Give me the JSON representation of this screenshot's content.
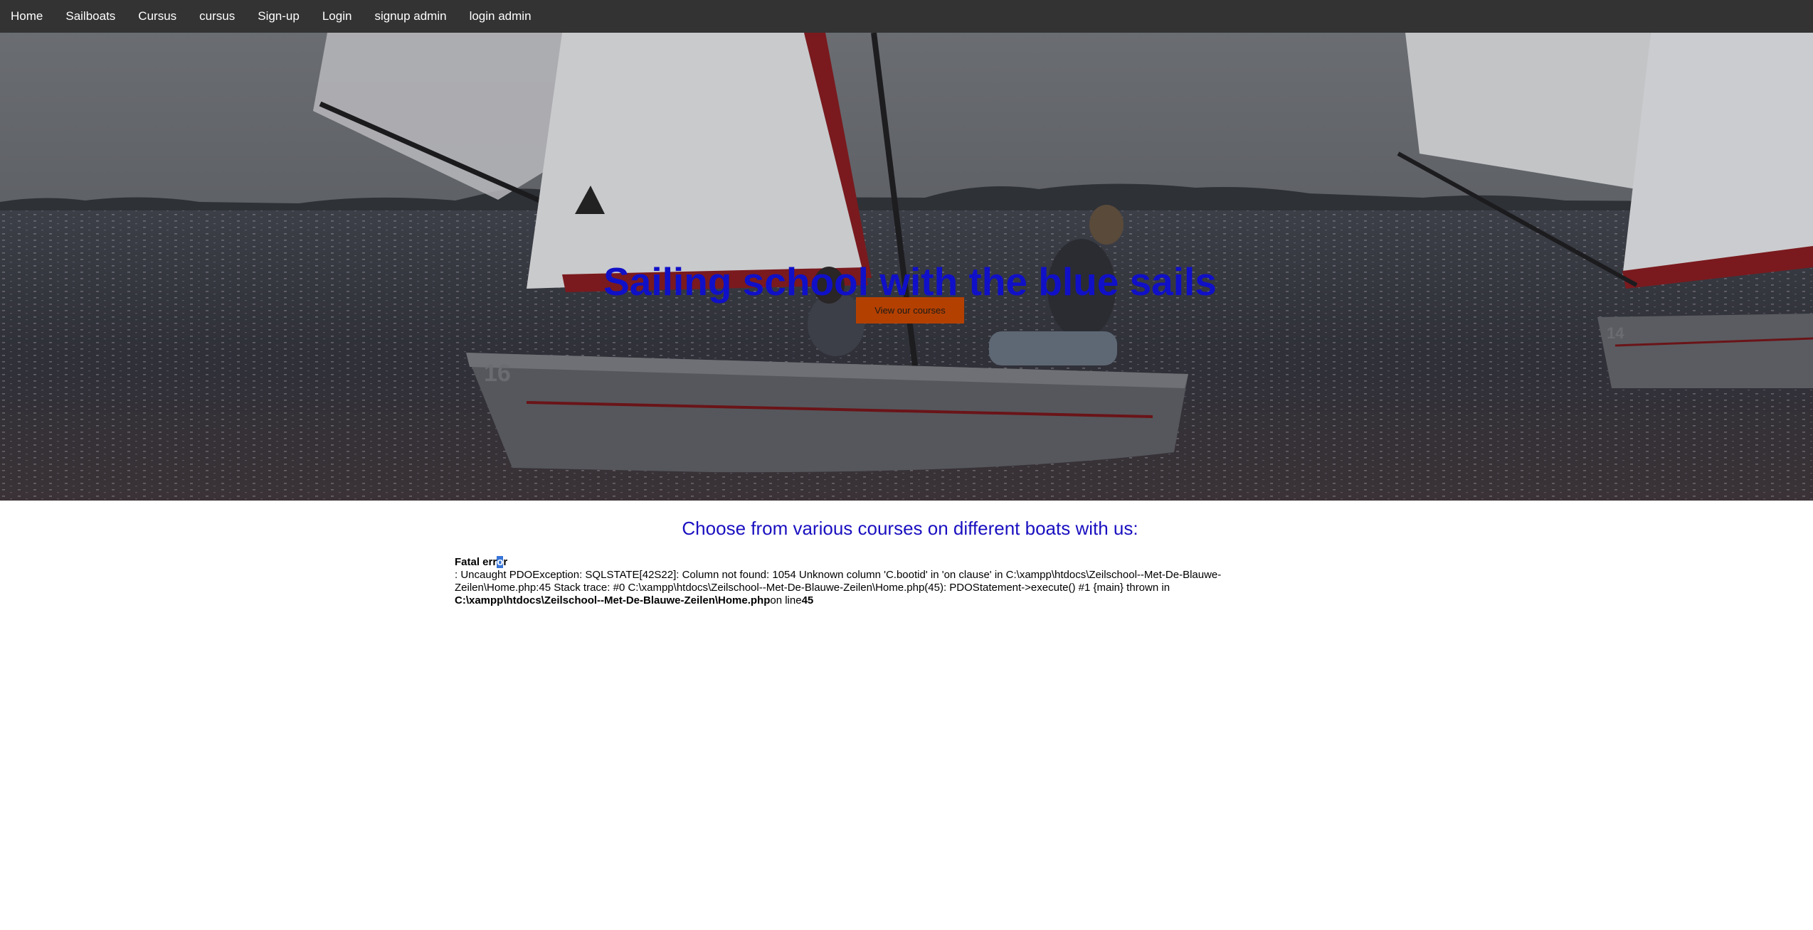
{
  "nav": {
    "items": [
      {
        "label": "Home"
      },
      {
        "label": "Sailboats"
      },
      {
        "label": "Cursus"
      },
      {
        "label": "cursus"
      },
      {
        "label": "Sign-up"
      },
      {
        "label": "Login"
      },
      {
        "label": "signup admin"
      },
      {
        "label": "login admin"
      }
    ]
  },
  "hero": {
    "title": "Sailing school with the blue sails",
    "button_label": "View our courses",
    "boat_number": "16",
    "boat_number_right": "14"
  },
  "main": {
    "subtitle": "Choose from various courses on different boats with us:"
  },
  "error": {
    "label_start": "Fatal err",
    "label_selected": "o",
    "label_end": "r",
    "message": ": Uncaught PDOException: SQLSTATE[42S22]: Column not found: 1054 Unknown column 'C.bootid' in 'on clause' in C:\\xampp\\htdocs\\Zeilschool--Met-De-Blauwe-Zeilen\\Home.php:45 Stack trace: #0 C:\\xampp\\htdocs\\Zeilschool--Met-De-Blauwe-Zeilen\\Home.php(45): PDOStatement->execute() #1 {main} thrown in",
    "file_path": "C:\\xampp\\htdocs\\Zeilschool--Met-De-Blauwe-Zeilen\\Home.php",
    "on_line_text": "on line",
    "line_number": "45"
  },
  "colors": {
    "nav_bg": "#333333",
    "title": "#1010c8",
    "subtitle": "#1a10c0",
    "button_bg": "#b44000"
  }
}
